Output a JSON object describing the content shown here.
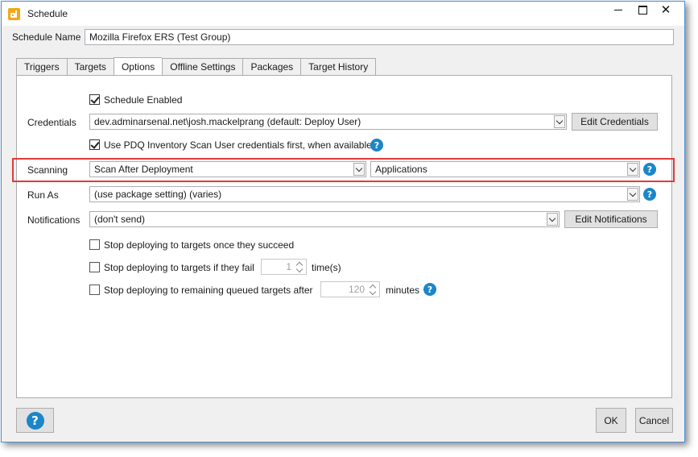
{
  "window": {
    "title": "Schedule",
    "minimize": "–",
    "maximize": "□",
    "close": "✕"
  },
  "schedule_name": {
    "label": "Schedule Name",
    "value": "Mozilla Firefox ERS (Test Group)"
  },
  "tabs": [
    {
      "label": "Triggers"
    },
    {
      "label": "Targets"
    },
    {
      "label": "Options"
    },
    {
      "label": "Offline Settings"
    },
    {
      "label": "Packages"
    },
    {
      "label": "Target History"
    }
  ],
  "options": {
    "schedule_enabled": {
      "label": "Schedule Enabled",
      "checked": true
    },
    "credentials": {
      "label": "Credentials",
      "value": "dev.adminarsenal.net\\josh.mackelprang (default: Deploy User)",
      "button": "Edit Credentials"
    },
    "use_pdq": {
      "label": "Use PDQ Inventory Scan User credentials first, when available",
      "checked": true
    },
    "scanning": {
      "label": "Scanning",
      "value": "Scan After Deployment",
      "profile": "Applications"
    },
    "run_as": {
      "label": "Run As",
      "value": "(use package setting) (varies)"
    },
    "notifications": {
      "label": "Notifications",
      "value": "(don't send)",
      "button": "Edit Notifications"
    },
    "stop_succeed": {
      "label": "Stop deploying to targets once they succeed",
      "checked": false
    },
    "stop_fail": {
      "label": "Stop deploying to targets if they fail",
      "value": "1",
      "suffix": "time(s)",
      "checked": false
    },
    "stop_queued": {
      "label": "Stop deploying to remaining queued targets after",
      "value": "120",
      "suffix": "minutes",
      "checked": false
    }
  },
  "help_glyph": "?",
  "footer": {
    "ok": "OK",
    "cancel": "Cancel"
  },
  "colors": {
    "highlight": "#e03a3a",
    "help_blue": "#1b86c8",
    "window_border": "#4a90d9"
  }
}
